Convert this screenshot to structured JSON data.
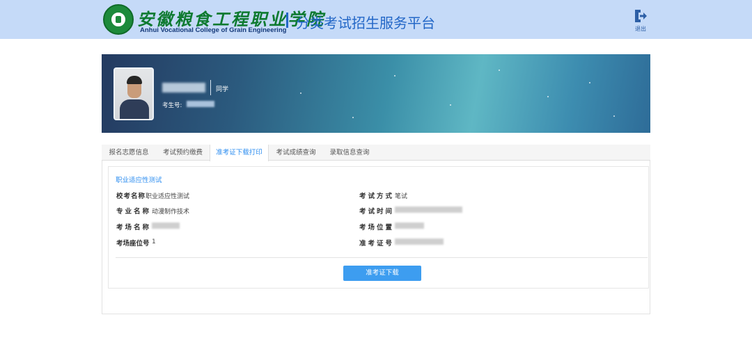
{
  "header": {
    "college_name_cn": "安徽粮食工程职业学院",
    "college_name_en": "Anhui Vocational College of Grain Engineering",
    "platform_title": "分类考试招生服务平台",
    "logout_label": "退出",
    "logout_icon": "logout-icon",
    "colors": {
      "header_bg": "#c5daf8",
      "accent_blue": "#2367c7",
      "logo_green": "#0e7a30"
    }
  },
  "profile": {
    "suffix": "同学",
    "exam_number_label": "考生号:"
  },
  "tabs": [
    {
      "label": "报名志愿信息",
      "active": false
    },
    {
      "label": "考试预约缴费",
      "active": false
    },
    {
      "label": "准考证下载打印",
      "active": true
    },
    {
      "label": "考试成绩查询",
      "active": false
    },
    {
      "label": "录取信息查询",
      "active": false
    }
  ],
  "admission": {
    "section_title": "职业适应性测试",
    "fields_left": [
      {
        "label": "校考名称",
        "value": "职业适应性测试"
      },
      {
        "label": "专业名称",
        "value": "动漫制作技术"
      },
      {
        "label": "考场名称",
        "value": ""
      },
      {
        "label": "考场座位号",
        "value": "1"
      }
    ],
    "fields_right": [
      {
        "label": "考试方式",
        "value": "笔试"
      },
      {
        "label": "考试时间",
        "value": ""
      },
      {
        "label": "考场位置",
        "value": ""
      },
      {
        "label": "准考证号",
        "value": ""
      }
    ],
    "download_button": "准考证下载",
    "colors": {
      "button_bg": "#3d9df0",
      "tab_active": "#2e8ef0"
    }
  }
}
